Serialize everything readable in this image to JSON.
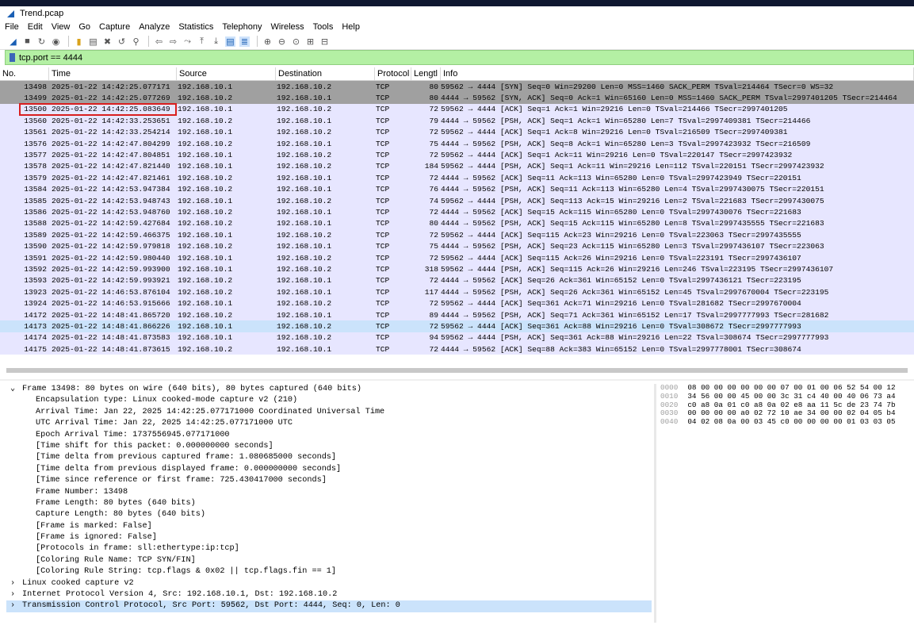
{
  "window": {
    "title": "Trend.pcap"
  },
  "menu": [
    "File",
    "Edit",
    "View",
    "Go",
    "Capture",
    "Analyze",
    "Statistics",
    "Telephony",
    "Wireless",
    "Tools",
    "Help"
  ],
  "toolbar_icons": [
    "shark-fin-start-icon",
    "stop-icon",
    "restart-icon",
    "options-icon",
    "open-icon",
    "save-icon",
    "close-file-icon",
    "reload-icon",
    "find-icon",
    "back-icon",
    "forward-icon",
    "goto-icon",
    "first-icon",
    "last-icon",
    "autoscroll-icon",
    "colorize-icon",
    "zoom-in-icon",
    "zoom-out-icon",
    "zoom-normal-icon",
    "resize-columns-icon",
    "layout-icon"
  ],
  "filter": {
    "value": "tcp.port == 4444"
  },
  "columns": {
    "no": "No.",
    "time": "Time",
    "source": "Source",
    "destination": "Destination",
    "protocol": "Protocol",
    "length": "Lengtl",
    "info": "Info"
  },
  "packets": [
    {
      "no": "13498",
      "time": "2025-01-22 14:42:25.077171",
      "src": "192.168.10.1",
      "dst": "192.168.10.2",
      "proto": "TCP",
      "len": "80",
      "info": "59562 → 4444 [SYN] Seq=0 Win=29200 Len=0 MSS=1460 SACK_PERM TSval=214464 TSecr=0 WS=32",
      "style": "syn"
    },
    {
      "no": "13499",
      "time": "2025-01-22 14:42:25.077269",
      "src": "192.168.10.2",
      "dst": "192.168.10.1",
      "proto": "TCP",
      "len": "80",
      "info": "4444 → 59562 [SYN, ACK] Seq=0 Ack=1 Win=65160 Len=0 MSS=1460 SACK_PERM TSval=2997401205 TSecr=214464",
      "style": "syn"
    },
    {
      "no": "13500",
      "time": "2025-01-22 14:42:25.083649",
      "src": "192.168.10.1",
      "dst": "192.168.10.2",
      "proto": "TCP",
      "len": "72",
      "info": "59562 → 4444 [ACK] Seq=1 Ack=1 Win=29216 Len=0 TSval=214466 TSecr=2997401205",
      "style": ""
    },
    {
      "no": "13560",
      "time": "2025-01-22 14:42:33.253651",
      "src": "192.168.10.2",
      "dst": "192.168.10.1",
      "proto": "TCP",
      "len": "79",
      "info": "4444 → 59562 [PSH, ACK] Seq=1 Ack=1 Win=65280 Len=7 TSval=2997409381 TSecr=214466",
      "style": ""
    },
    {
      "no": "13561",
      "time": "2025-01-22 14:42:33.254214",
      "src": "192.168.10.1",
      "dst": "192.168.10.2",
      "proto": "TCP",
      "len": "72",
      "info": "59562 → 4444 [ACK] Seq=1 Ack=8 Win=29216 Len=0 TSval=216509 TSecr=2997409381",
      "style": ""
    },
    {
      "no": "13576",
      "time": "2025-01-22 14:42:47.804299",
      "src": "192.168.10.2",
      "dst": "192.168.10.1",
      "proto": "TCP",
      "len": "75",
      "info": "4444 → 59562 [PSH, ACK] Seq=8 Ack=1 Win=65280 Len=3 TSval=2997423932 TSecr=216509",
      "style": ""
    },
    {
      "no": "13577",
      "time": "2025-01-22 14:42:47.804851",
      "src": "192.168.10.1",
      "dst": "192.168.10.2",
      "proto": "TCP",
      "len": "72",
      "info": "59562 → 4444 [ACK] Seq=1 Ack=11 Win=29216 Len=0 TSval=220147 TSecr=2997423932",
      "style": ""
    },
    {
      "no": "13578",
      "time": "2025-01-22 14:42:47.821440",
      "src": "192.168.10.1",
      "dst": "192.168.10.2",
      "proto": "TCP",
      "len": "184",
      "info": "59562 → 4444 [PSH, ACK] Seq=1 Ack=11 Win=29216 Len=112 TSval=220151 TSecr=2997423932",
      "style": ""
    },
    {
      "no": "13579",
      "time": "2025-01-22 14:42:47.821461",
      "src": "192.168.10.2",
      "dst": "192.168.10.1",
      "proto": "TCP",
      "len": "72",
      "info": "4444 → 59562 [ACK] Seq=11 Ack=113 Win=65280 Len=0 TSval=2997423949 TSecr=220151",
      "style": ""
    },
    {
      "no": "13584",
      "time": "2025-01-22 14:42:53.947384",
      "src": "192.168.10.2",
      "dst": "192.168.10.1",
      "proto": "TCP",
      "len": "76",
      "info": "4444 → 59562 [PSH, ACK] Seq=11 Ack=113 Win=65280 Len=4 TSval=2997430075 TSecr=220151",
      "style": ""
    },
    {
      "no": "13585",
      "time": "2025-01-22 14:42:53.948743",
      "src": "192.168.10.1",
      "dst": "192.168.10.2",
      "proto": "TCP",
      "len": "74",
      "info": "59562 → 4444 [PSH, ACK] Seq=113 Ack=15 Win=29216 Len=2 TSval=221683 TSecr=2997430075",
      "style": ""
    },
    {
      "no": "13586",
      "time": "2025-01-22 14:42:53.948760",
      "src": "192.168.10.2",
      "dst": "192.168.10.1",
      "proto": "TCP",
      "len": "72",
      "info": "4444 → 59562 [ACK] Seq=15 Ack=115 Win=65280 Len=0 TSval=2997430076 TSecr=221683",
      "style": ""
    },
    {
      "no": "13588",
      "time": "2025-01-22 14:42:59.427684",
      "src": "192.168.10.2",
      "dst": "192.168.10.1",
      "proto": "TCP",
      "len": "80",
      "info": "4444 → 59562 [PSH, ACK] Seq=15 Ack=115 Win=65280 Len=8 TSval=2997435555 TSecr=221683",
      "style": ""
    },
    {
      "no": "13589",
      "time": "2025-01-22 14:42:59.466375",
      "src": "192.168.10.1",
      "dst": "192.168.10.2",
      "proto": "TCP",
      "len": "72",
      "info": "59562 → 4444 [ACK] Seq=115 Ack=23 Win=29216 Len=0 TSval=223063 TSecr=2997435555",
      "style": ""
    },
    {
      "no": "13590",
      "time": "2025-01-22 14:42:59.979818",
      "src": "192.168.10.2",
      "dst": "192.168.10.1",
      "proto": "TCP",
      "len": "75",
      "info": "4444 → 59562 [PSH, ACK] Seq=23 Ack=115 Win=65280 Len=3 TSval=2997436107 TSecr=223063",
      "style": ""
    },
    {
      "no": "13591",
      "time": "2025-01-22 14:42:59.980440",
      "src": "192.168.10.1",
      "dst": "192.168.10.2",
      "proto": "TCP",
      "len": "72",
      "info": "59562 → 4444 [ACK] Seq=115 Ack=26 Win=29216 Len=0 TSval=223191 TSecr=2997436107",
      "style": ""
    },
    {
      "no": "13592",
      "time": "2025-01-22 14:42:59.993900",
      "src": "192.168.10.1",
      "dst": "192.168.10.2",
      "proto": "TCP",
      "len": "318",
      "info": "59562 → 4444 [PSH, ACK] Seq=115 Ack=26 Win=29216 Len=246 TSval=223195 TSecr=2997436107",
      "style": ""
    },
    {
      "no": "13593",
      "time": "2025-01-22 14:42:59.993921",
      "src": "192.168.10.2",
      "dst": "192.168.10.1",
      "proto": "TCP",
      "len": "72",
      "info": "4444 → 59562 [ACK] Seq=26 Ack=361 Win=65152 Len=0 TSval=2997436121 TSecr=223195",
      "style": ""
    },
    {
      "no": "13923",
      "time": "2025-01-22 14:46:53.876104",
      "src": "192.168.10.2",
      "dst": "192.168.10.1",
      "proto": "TCP",
      "len": "117",
      "info": "4444 → 59562 [PSH, ACK] Seq=26 Ack=361 Win=65152 Len=45 TSval=2997670004 TSecr=223195",
      "style": ""
    },
    {
      "no": "13924",
      "time": "2025-01-22 14:46:53.915666",
      "src": "192.168.10.1",
      "dst": "192.168.10.2",
      "proto": "TCP",
      "len": "72",
      "info": "59562 → 4444 [ACK] Seq=361 Ack=71 Win=29216 Len=0 TSval=281682 TSecr=2997670004",
      "style": ""
    },
    {
      "no": "14172",
      "time": "2025-01-22 14:48:41.865720",
      "src": "192.168.10.2",
      "dst": "192.168.10.1",
      "proto": "TCP",
      "len": "89",
      "info": "4444 → 59562 [PSH, ACK] Seq=71 Ack=361 Win=65152 Len=17 TSval=2997777993 TSecr=281682",
      "style": ""
    },
    {
      "no": "14173",
      "time": "2025-01-22 14:48:41.866226",
      "src": "192.168.10.1",
      "dst": "192.168.10.2",
      "proto": "TCP",
      "len": "72",
      "info": "59562 → 4444 [ACK] Seq=361 Ack=88 Win=29216 Len=0 TSval=308672 TSecr=2997777993",
      "style": "sel"
    },
    {
      "no": "14174",
      "time": "2025-01-22 14:48:41.873583",
      "src": "192.168.10.1",
      "dst": "192.168.10.2",
      "proto": "TCP",
      "len": "94",
      "info": "59562 → 4444 [PSH, ACK] Seq=361 Ack=88 Win=29216 Len=22 TSval=308674 TSecr=2997777993",
      "style": ""
    },
    {
      "no": "14175",
      "time": "2025-01-22 14:48:41.873615",
      "src": "192.168.10.2",
      "dst": "192.168.10.1",
      "proto": "TCP",
      "len": "72",
      "info": "4444 → 59562 [ACK] Seq=88 Ack=383 Win=65152 Len=0 TSval=2997778001 TSecr=308674",
      "style": ""
    }
  ],
  "details": {
    "frame_title": "Frame 13498: 80 bytes on wire (640 bits), 80 bytes captured (640 bits)",
    "frame_lines": [
      "Encapsulation type: Linux cooked-mode capture v2 (210)",
      "Arrival Time: Jan 22, 2025 14:42:25.077171000 Coordinated Universal Time",
      "UTC Arrival Time: Jan 22, 2025 14:42:25.077171000 UTC",
      "Epoch Arrival Time: 1737556945.077171000",
      "[Time shift for this packet: 0.000000000 seconds]",
      "[Time delta from previous captured frame: 1.080685000 seconds]",
      "[Time delta from previous displayed frame: 0.000000000 seconds]",
      "[Time since reference or first frame: 725.430417000 seconds]",
      "Frame Number: 13498",
      "Frame Length: 80 bytes (640 bits)",
      "Capture Length: 80 bytes (640 bits)",
      "[Frame is marked: False]",
      "[Frame is ignored: False]",
      "[Protocols in frame: sll:ethertype:ip:tcp]",
      "[Coloring Rule Name: TCP SYN/FIN]",
      "[Coloring Rule String: tcp.flags & 0x02 || tcp.flags.fin == 1]"
    ],
    "sll": "Linux cooked capture v2",
    "ip": "Internet Protocol Version 4, Src: 192.168.10.1, Dst: 192.168.10.2",
    "tcp": "Transmission Control Protocol, Src Port: 59562, Dst Port: 4444, Seq: 0, Len: 0"
  },
  "bytes": [
    {
      "off": "0000",
      "hex": "08 00 00 00 00 00 00 07  00 01 00 06 52 54 00 12"
    },
    {
      "off": "0010",
      "hex": "34 56 00 00 45 00 00 3c  31 c4 40 00 40 06 73 a4"
    },
    {
      "off": "0020",
      "hex": "c0 a8 0a 01 c0 a8 0a 02  e8 aa 11 5c de 23 74 7b"
    },
    {
      "off": "0030",
      "hex": "00 00 00 00 a0 02 72 10  ae 34 00 00 02 04 05 b4"
    },
    {
      "off": "0040",
      "hex": "04 02 08 0a 00 03 45 c0  00 00 00 00 01 03 03 05"
    }
  ],
  "colors": {
    "syn_row": "#a0a0a0",
    "tcp_row": "#e7e6ff",
    "selected": "#cbe3fb",
    "filter_ok": "#b4f0a4",
    "highlight": "#d91f1f"
  }
}
